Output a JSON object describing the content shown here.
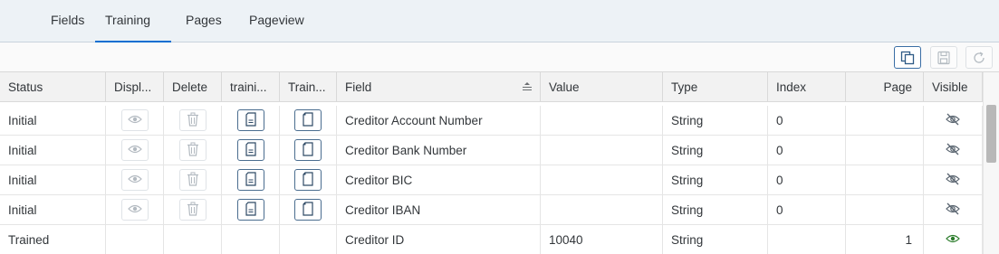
{
  "tabs": [
    {
      "label": "Fields",
      "active": false
    },
    {
      "label": "Training",
      "active": true
    },
    {
      "label": "Pages",
      "active": false
    },
    {
      "label": "Pageview",
      "active": false
    }
  ],
  "toolbar": {
    "buttons": [
      {
        "icon": "copy-icon",
        "enabled": true
      },
      {
        "icon": "save-icon",
        "enabled": false
      },
      {
        "icon": "refresh-icon",
        "enabled": false
      }
    ]
  },
  "table": {
    "columns": [
      "Status",
      "Displ...",
      "Delete",
      "traini...",
      "Train...",
      "Field",
      "Value",
      "Type",
      "Index",
      "Page",
      "Visible"
    ],
    "sorted_column": "Field",
    "rows": [
      {
        "status": "Initial",
        "field": "Creditor Account Number",
        "value": "",
        "type": "String",
        "index": "0",
        "page": "",
        "visible": false,
        "has_actions": true
      },
      {
        "status": "Initial",
        "field": "Creditor Bank Number",
        "value": "",
        "type": "String",
        "index": "0",
        "page": "",
        "visible": false,
        "has_actions": true
      },
      {
        "status": "Initial",
        "field": "Creditor BIC",
        "value": "",
        "type": "String",
        "index": "0",
        "page": "",
        "visible": false,
        "has_actions": true
      },
      {
        "status": "Initial",
        "field": "Creditor IBAN",
        "value": "",
        "type": "String",
        "index": "0",
        "page": "",
        "visible": false,
        "has_actions": true
      },
      {
        "status": "Trained",
        "field": "Creditor ID",
        "value": "10040",
        "type": "String",
        "index": "",
        "page": "1",
        "visible": true,
        "has_actions": false
      }
    ]
  },
  "colors": {
    "accent": "#0a6ed1",
    "visible_icon": "#2b7c2b",
    "hidden_icon": "#5a6570"
  }
}
